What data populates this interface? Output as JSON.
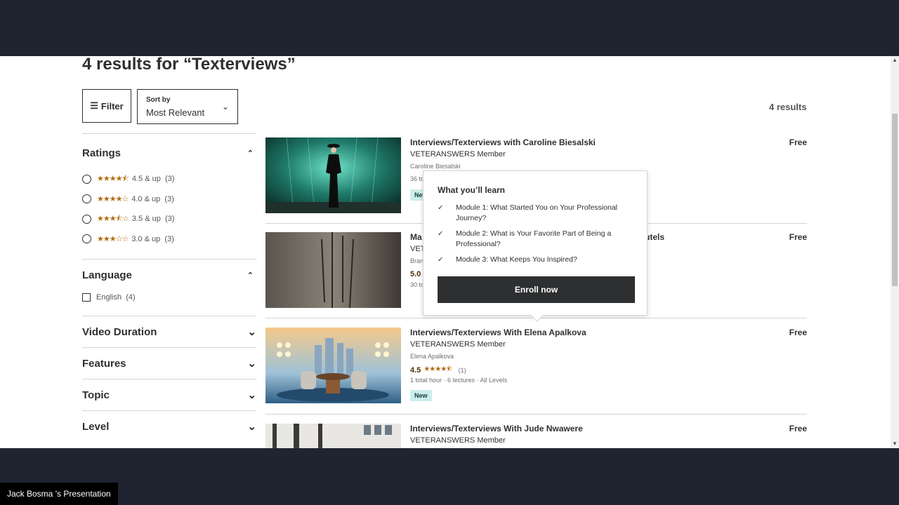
{
  "page": {
    "heading": "4 results for “Texterviews”",
    "filter_label": "Filter",
    "sort_label": "Sort by",
    "sort_value": "Most Relevant",
    "results_count": "4 results"
  },
  "sidebar": {
    "ratings_title": "Ratings",
    "ratings": [
      {
        "stars": "★★★★⯪",
        "label": "4.5 & up",
        "count": "(3)",
        "value": 4.5
      },
      {
        "stars": "★★★★☆",
        "label": "4.0 & up",
        "count": "(3)",
        "value": 4.0
      },
      {
        "stars": "★★★⯪☆",
        "label": "3.5 & up",
        "count": "(3)",
        "value": 3.5
      },
      {
        "stars": "★★★☆☆",
        "label": "3.0 & up",
        "count": "(3)",
        "value": 3.0
      }
    ],
    "language_title": "Language",
    "language_option": "English",
    "language_count": "(4)",
    "collapsed_sections": [
      "Video Duration",
      "Features",
      "Topic",
      "Level"
    ]
  },
  "courses": [
    {
      "title": "Interviews/Texterviews with Caroline Biesalski",
      "subtitle": "VETERANSWERS Member",
      "instructor": "Caroline Biesalski",
      "meta": "36 to",
      "badge": "New",
      "price": "Free"
    },
    {
      "title": "Ma",
      "title_tail": "utels",
      "subtitle": "VET",
      "instructor": "Bran",
      "rating": "5.0",
      "meta": "30 to",
      "price": "Free"
    },
    {
      "title": "Interviews/Texterviews With Elena Apalkova",
      "subtitle": "VETERANSWERS Member",
      "instructor": "Elena Apalkova",
      "rating": "4.5",
      "stars": "★★★★⯪",
      "rating_count": "(1)",
      "meta": "1 total hour · 6 lectures · All Levels",
      "badge": "New",
      "price": "Free"
    },
    {
      "title": "Interviews/Texterviews With Jude Nwawere",
      "subtitle": "VETERANSWERS Member",
      "price": "Free"
    }
  ],
  "popover": {
    "title": "What you’ll learn",
    "items": [
      "Module 1: What Started You on Your Professional Journey?",
      "Module 2: What is Your Favorite Part of Being a Professional?",
      "Module 3: What Keeps You Inspired?"
    ],
    "cta": "Enroll now"
  },
  "presenter": "Jack Bosma 's Presentation",
  "colors": {
    "star": "#b4690e",
    "badge_bg": "#cceeeb",
    "dark": "#2d2f31",
    "frame": "#1f2430"
  }
}
